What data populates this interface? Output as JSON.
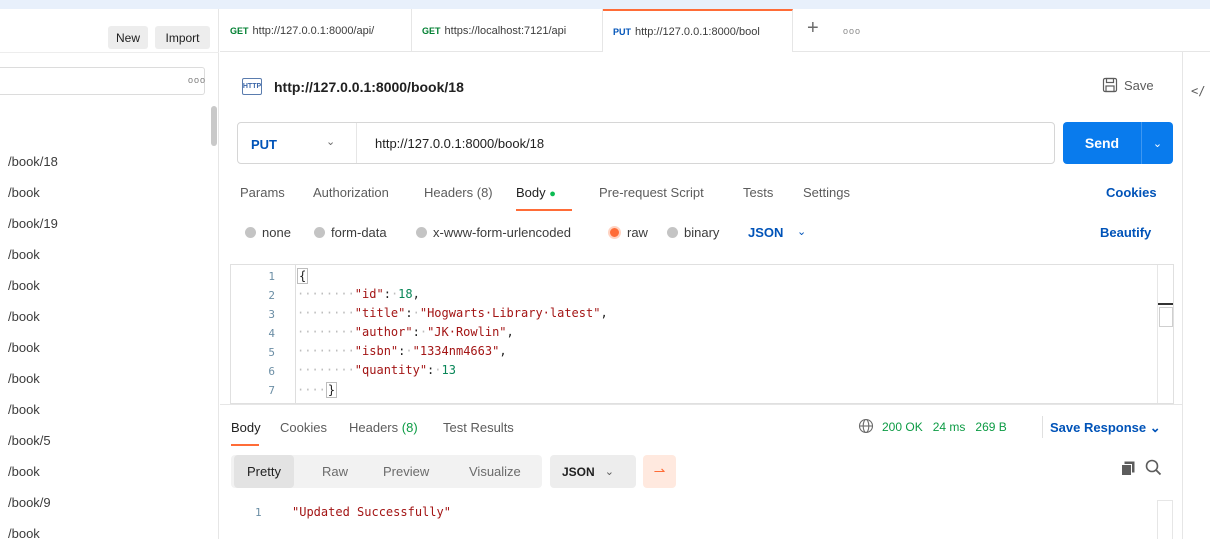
{
  "sidebar": {
    "new_label": "New",
    "import_label": "Import",
    "more_label": "ooo",
    "items": [
      "/book/18",
      "/book",
      "/book/19",
      "/book",
      "/book",
      "/book",
      "/book",
      "/book",
      "/book",
      "/book/5",
      "/book",
      "/book/9",
      "/book"
    ]
  },
  "tabs": [
    {
      "method": "GET",
      "label": "http://127.0.0.1:8000/api/"
    },
    {
      "method": "GET",
      "label": "https://localhost:7121/api"
    },
    {
      "method": "PUT",
      "label": "http://127.0.0.1:8000/bool"
    }
  ],
  "tabbar": {
    "plus": "+",
    "more": "ooo"
  },
  "request": {
    "icon_label": "HTTP",
    "title": "http://127.0.0.1:8000/book/18",
    "save_label": "Save",
    "method": "PUT",
    "url": "http://127.0.0.1:8000/book/18",
    "send_label": "Send"
  },
  "request_tabs": {
    "params": "Params",
    "authorization": "Authorization",
    "headers": "Headers (8)",
    "body": "Body",
    "body_dot": "●",
    "prerequest": "Pre-request Script",
    "tests": "Tests",
    "settings": "Settings",
    "cookies": "Cookies"
  },
  "body_types": {
    "none": "none",
    "form_data": "form-data",
    "urlencoded": "x-www-form-urlencoded",
    "raw": "raw",
    "binary": "binary",
    "format": "JSON",
    "beautify": "Beautify",
    "selected": "raw"
  },
  "editor": {
    "line_numbers": [
      "1",
      "2",
      "3",
      "4",
      "5",
      "6",
      "7"
    ],
    "id_key": "\"id\"",
    "id_val": "18",
    "title_key": "\"title\"",
    "title_val": "\"Hogwarts·Library·latest\"",
    "author_key": "\"author\"",
    "author_val": "\"JK·Rowlin\"",
    "isbn_key": "\"isbn\"",
    "isbn_val": "\"1334nm4663\"",
    "qty_key": "\"quantity\"",
    "qty_val": "13"
  },
  "response": {
    "tabs": {
      "body": "Body",
      "cookies": "Cookies",
      "headers_label": "Headers",
      "headers_count": "(8)",
      "tests": "Test Results"
    },
    "status": "200 OK",
    "time": "24 ms",
    "size": "269 B",
    "save_label": "Save Response",
    "formats": {
      "pretty": "Pretty",
      "raw": "Raw",
      "preview": "Preview",
      "visualize": "Visualize"
    },
    "lang": "JSON",
    "line": "1",
    "content": "\"Updated Successfully\""
  },
  "colors": {
    "accent": "#ff6c37",
    "primary": "#097bed",
    "success": "#0c9b44"
  }
}
